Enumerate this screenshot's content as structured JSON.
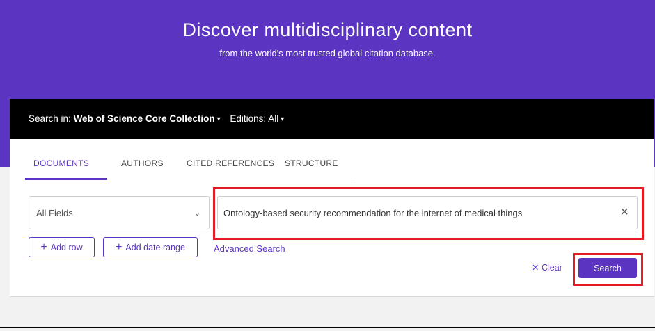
{
  "hero": {
    "title": "Discover multidisciplinary content",
    "subtitle": "from the world's most trusted global citation database."
  },
  "search_bar": {
    "prefix": "Search in:",
    "collection": "Web of Science Core Collection",
    "editions": "Editions: All"
  },
  "tabs": [
    {
      "label": "DOCUMENTS",
      "active": true
    },
    {
      "label": "AUTHORS",
      "active": false
    },
    {
      "label": "CITED REFERENCES",
      "active": false
    },
    {
      "label": "STRUCTURE",
      "active": false
    }
  ],
  "form": {
    "field_select": "All Fields",
    "query_value": "Ontology-based security recommendation for the internet of medical things",
    "add_row": "Add row",
    "add_date_range": "Add date range",
    "advanced_search": "Advanced Search",
    "clear": "Clear",
    "search": "Search"
  },
  "colors": {
    "brand": "#5b35c2",
    "highlight": "#e51b23"
  }
}
